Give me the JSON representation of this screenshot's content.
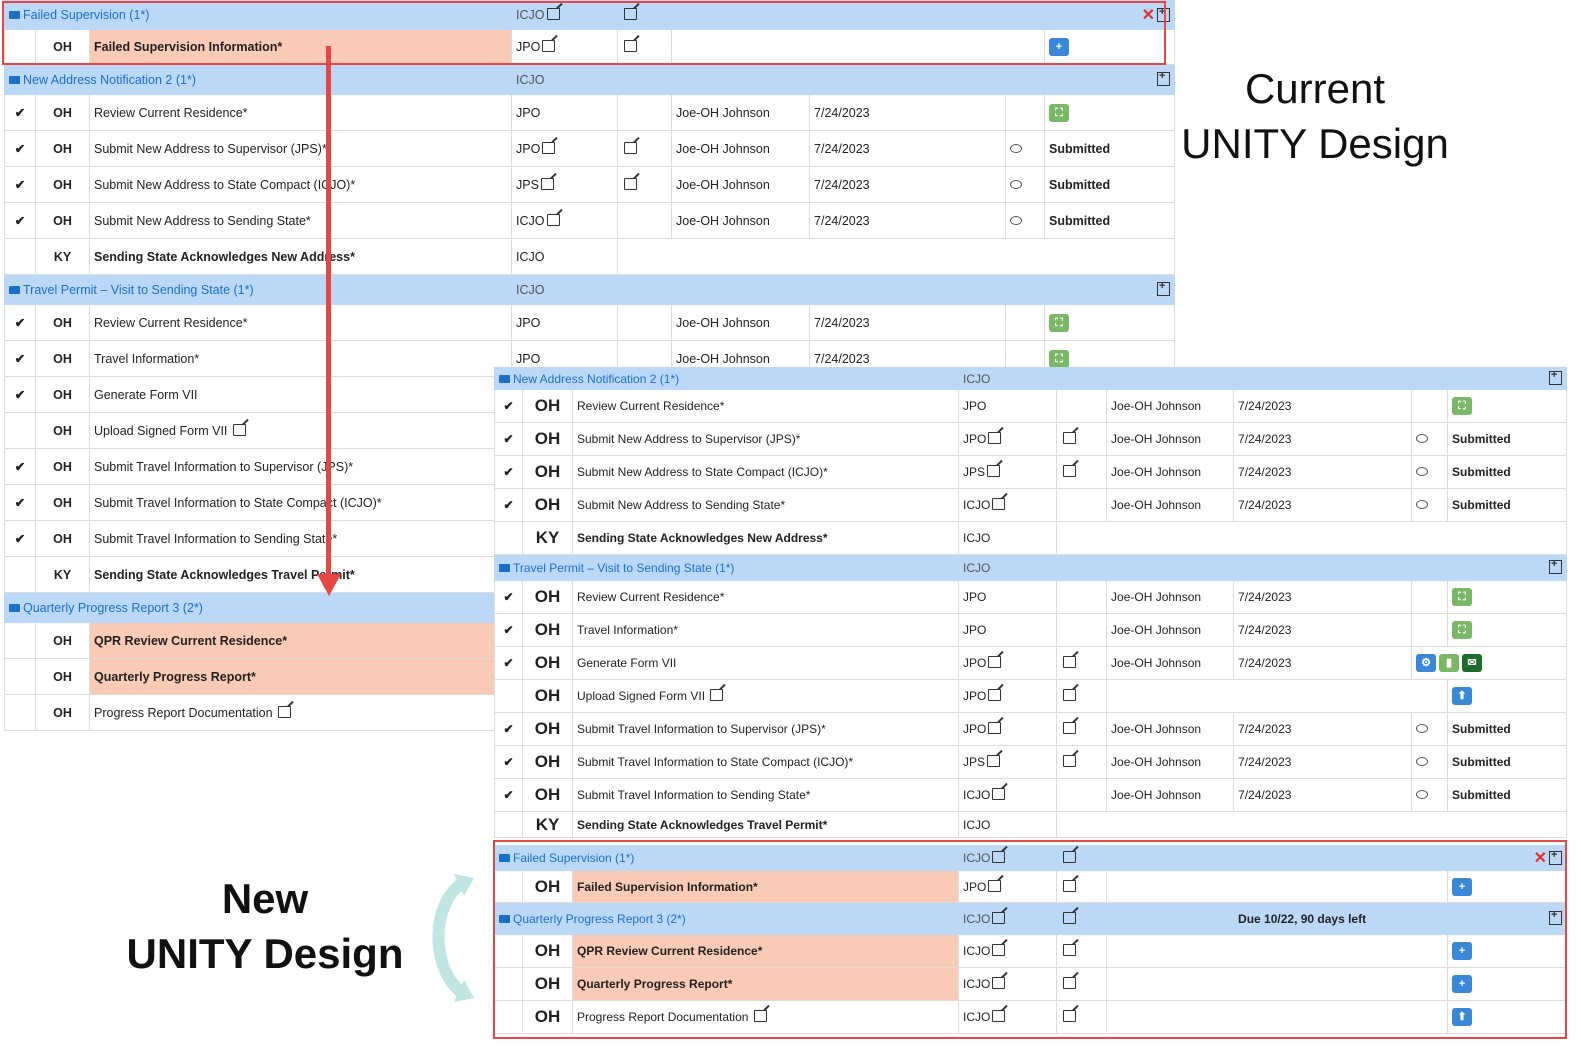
{
  "labels": {
    "current_title": "Current",
    "current_sub": "UNITY Design",
    "new_title": "New",
    "new_sub": "UNITY Design"
  },
  "colors": {
    "header_bg": "#bcd8f7",
    "header_text": "#1a6fc9",
    "highlight_row": "#f9cbb6",
    "red_outline": "#e84545",
    "check": "#2a9c2a"
  },
  "current": {
    "failed": {
      "header": {
        "title": "Failed Supervision (1*)",
        "role": "ICJO"
      },
      "rows": [
        {
          "state": "OH",
          "task": "Failed Supervision Information*",
          "role": "JPO"
        }
      ]
    },
    "address": {
      "header": {
        "title": "New Address Notification 2 (1*)",
        "role": "ICJO"
      },
      "rows": [
        {
          "check": "✔",
          "state": "OH",
          "task": "Review Current Residence*",
          "role": "JPO",
          "user": "Joe-OH Johnson",
          "date": "7/24/2023",
          "status": ""
        },
        {
          "check": "✔",
          "state": "OH",
          "task": "Submit New Address to Supervisor (JPS)*",
          "role": "JPO",
          "user": "Joe-OH Johnson",
          "date": "7/24/2023",
          "status": "Submitted"
        },
        {
          "check": "✔",
          "state": "OH",
          "task": "Submit New Address to State Compact (ICJO)*",
          "role": "JPS",
          "user": "Joe-OH Johnson",
          "date": "7/24/2023",
          "status": "Submitted"
        },
        {
          "check": "✔",
          "state": "OH",
          "task": "Submit New Address to Sending State*",
          "role": "ICJO",
          "user": "Joe-OH Johnson",
          "date": "7/24/2023",
          "status": "Submitted"
        },
        {
          "check": "",
          "state": "KY",
          "task": "Sending State Acknowledges New Address*",
          "role": "ICJO",
          "user": "",
          "date": "",
          "status": ""
        }
      ]
    },
    "travel": {
      "header": {
        "title": "Travel Permit – Visit to Sending State (1*)",
        "role": "ICJO"
      },
      "rows": [
        {
          "check": "✔",
          "state": "OH",
          "task": "Review Current Residence*",
          "role": "JPO",
          "user": "Joe-OH Johnson",
          "date": "7/24/2023"
        },
        {
          "check": "✔",
          "state": "OH",
          "task": "Travel Information*",
          "role": "JPO",
          "user": "Joe-OH Johnson",
          "date": "7/24/2023"
        },
        {
          "check": "✔",
          "state": "OH",
          "task": "Generate Form VII"
        },
        {
          "check": "",
          "state": "OH",
          "task": "Upload Signed Form VII"
        },
        {
          "check": "✔",
          "state": "OH",
          "task": "Submit Travel Information to Supervisor (JPS)*"
        },
        {
          "check": "✔",
          "state": "OH",
          "task": "Submit Travel Information to State Compact (ICJO)*"
        },
        {
          "check": "✔",
          "state": "OH",
          "task": "Submit Travel Information to Sending State*"
        },
        {
          "check": "",
          "state": "KY",
          "task": "Sending State Acknowledges Travel Permit*"
        }
      ]
    },
    "qpr": {
      "header": {
        "title": "Quarterly Progress Report 3 (2*)"
      },
      "rows": [
        {
          "state": "OH",
          "task": "QPR Review Current Residence*"
        },
        {
          "state": "OH",
          "task": "Quarterly Progress Report*"
        },
        {
          "state": "OH",
          "task": "Progress Report Documentation"
        }
      ]
    }
  },
  "newdesign": {
    "address": {
      "header": {
        "title": "New Address Notification 2 (1*)",
        "role": "ICJO"
      },
      "rows": [
        {
          "check": "✔",
          "state": "OH",
          "task": "Review Current Residence*",
          "role": "JPO",
          "user": "Joe-OH Johnson",
          "date": "7/24/2023",
          "status": ""
        },
        {
          "check": "✔",
          "state": "OH",
          "task": "Submit New Address to Supervisor (JPS)*",
          "role": "JPO",
          "user": "Joe-OH Johnson",
          "date": "7/24/2023",
          "status": "Submitted"
        },
        {
          "check": "✔",
          "state": "OH",
          "task": "Submit New Address to State Compact (ICJO)*",
          "role": "JPS",
          "user": "Joe-OH Johnson",
          "date": "7/24/2023",
          "status": "Submitted"
        },
        {
          "check": "✔",
          "state": "OH",
          "task": "Submit New Address to Sending State*",
          "role": "ICJO",
          "user": "Joe-OH Johnson",
          "date": "7/24/2023",
          "status": "Submitted"
        },
        {
          "check": "",
          "state": "KY",
          "task": "Sending State Acknowledges New Address*",
          "role": "ICJO",
          "user": "",
          "date": "",
          "status": ""
        }
      ]
    },
    "travel": {
      "header": {
        "title": "Travel Permit – Visit to Sending State (1*)",
        "role": "ICJO"
      },
      "rows": [
        {
          "check": "✔",
          "state": "OH",
          "task": "Review Current Residence*",
          "role": "JPO",
          "user": "Joe-OH Johnson",
          "date": "7/24/2023",
          "status": ""
        },
        {
          "check": "✔",
          "state": "OH",
          "task": "Travel Information*",
          "role": "JPO",
          "user": "Joe-OH Johnson",
          "date": "7/24/2023",
          "status": ""
        },
        {
          "check": "✔",
          "state": "OH",
          "task": "Generate Form VII",
          "role": "JPO",
          "user": "Joe-OH Johnson",
          "date": "7/24/2023",
          "status": ""
        },
        {
          "check": "",
          "state": "OH",
          "task": "Upload Signed Form VII",
          "role": "JPO",
          "user": "",
          "date": "",
          "status": ""
        },
        {
          "check": "✔",
          "state": "OH",
          "task": "Submit Travel Information to Supervisor (JPS)*",
          "role": "JPO",
          "user": "Joe-OH Johnson",
          "date": "7/24/2023",
          "status": "Submitted"
        },
        {
          "check": "✔",
          "state": "OH",
          "task": "Submit Travel Information to State Compact (ICJO)*",
          "role": "JPS",
          "user": "Joe-OH Johnson",
          "date": "7/24/2023",
          "status": "Submitted"
        },
        {
          "check": "✔",
          "state": "OH",
          "task": "Submit Travel Information to Sending State*",
          "role": "ICJO",
          "user": "Joe-OH Johnson",
          "date": "7/24/2023",
          "status": "Submitted"
        },
        {
          "check": "",
          "state": "KY",
          "task": "Sending State Acknowledges Travel Permit*",
          "role": "ICJO",
          "user": "",
          "date": "",
          "status": ""
        }
      ]
    },
    "failed": {
      "header": {
        "title": "Failed Supervision (1*)",
        "role": "ICJO"
      },
      "rows": [
        {
          "state": "OH",
          "task": "Failed Supervision Information*",
          "role": "JPO"
        }
      ]
    },
    "qpr": {
      "header": {
        "title": "Quarterly Progress Report 3 (2*)",
        "role": "ICJO",
        "due": "Due 10/22, 90 days left"
      },
      "rows": [
        {
          "state": "OH",
          "task": "QPR Review Current Residence*",
          "role": "ICJO"
        },
        {
          "state": "OH",
          "task": "Quarterly Progress Report*",
          "role": "ICJO"
        },
        {
          "state": "OH",
          "task": "Progress Report Documentation",
          "role": "ICJO"
        }
      ]
    }
  }
}
